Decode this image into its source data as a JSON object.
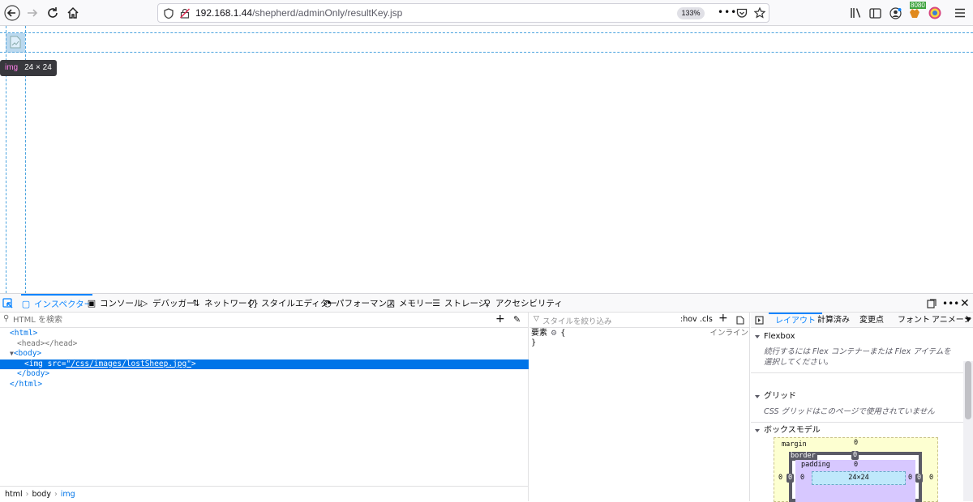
{
  "browser": {
    "url_host": "192.168.1.44",
    "url_path": "/shepherd/adminOnly/resultKey.jsp",
    "zoom": "133%",
    "extension_badge": "8080"
  },
  "page": {
    "infobar_tag": "img",
    "infobar_size": "24 × 24"
  },
  "devtools": {
    "tabs": [
      "インスペクター",
      "コンソール",
      "デバッガー",
      "ネットワーク",
      "スタイルエディター",
      "パフォーマンス",
      "メモリー",
      "ストレージ",
      "アクセシビリティ"
    ],
    "markup": {
      "search_placeholder": "HTML を検索",
      "lines": {
        "html_open": "<html>",
        "head": "<head></head>",
        "body_open": "<body>",
        "img_prefix": "<img src=",
        "img_src": "\"/css/images/lostSheep.jpg\"",
        "img_suffix": ">",
        "body_close": "</body>",
        "html_close": "</html>"
      },
      "breadcrumbs": [
        "html",
        "body",
        "img"
      ]
    },
    "rules": {
      "filter_placeholder": "スタイルを絞り込み",
      "hov": ":hov",
      "cls": ".cls",
      "element_label": "要素",
      "brace_open": "{",
      "brace_close": "}",
      "inline_label": "インライン"
    },
    "layout": {
      "tabs": [
        "レイアウト",
        "計算済み",
        "変更点",
        "フォント",
        "アニメーシ"
      ],
      "flexbox_title": "Flexbox",
      "flexbox_note": "続行するには Flex コンテナーまたは Flex アイテムを選択してください。",
      "grid_title": "グリッド",
      "grid_note": "CSS グリッドはこのページで使用されていません",
      "boxmodel_title": "ボックスモデル",
      "boxmodel": {
        "margin_label": "margin",
        "border_label": "border",
        "padding_label": "padding",
        "content_size": "24×24",
        "zero": "0"
      }
    }
  }
}
